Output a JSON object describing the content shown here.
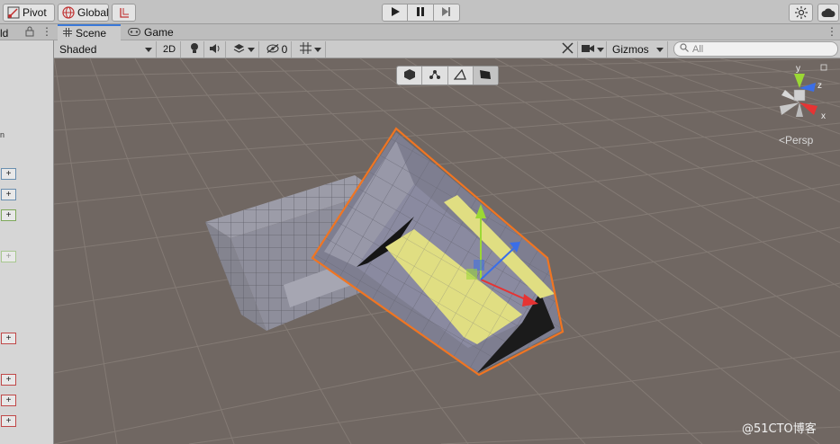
{
  "toolbar": {
    "pivot_label": "Pivot",
    "global_label": "Global"
  },
  "hierarchy": {
    "tab_label": "ld",
    "plus_label": "+"
  },
  "tabs": [
    {
      "label": "Scene"
    },
    {
      "label": "Game"
    }
  ],
  "scene_toolbar": {
    "shading_mode": "Shaded",
    "mode_2d": "2D",
    "hidden_count": "0",
    "gizmos_label": "Gizmos",
    "search_placeholder": "All"
  },
  "viewport": {
    "gizmo_axes": {
      "y": "y",
      "z": "z",
      "x": "x"
    },
    "projection_label": "<Persp",
    "watermark": "@51CTO博客"
  },
  "colors": {
    "selection_outline": "#f07522",
    "selected_face": "#e0de82",
    "axis_x": "#e63333",
    "axis_y": "#9bd834",
    "axis_z": "#3a6ee8",
    "accent_tab": "#3a79d9"
  }
}
